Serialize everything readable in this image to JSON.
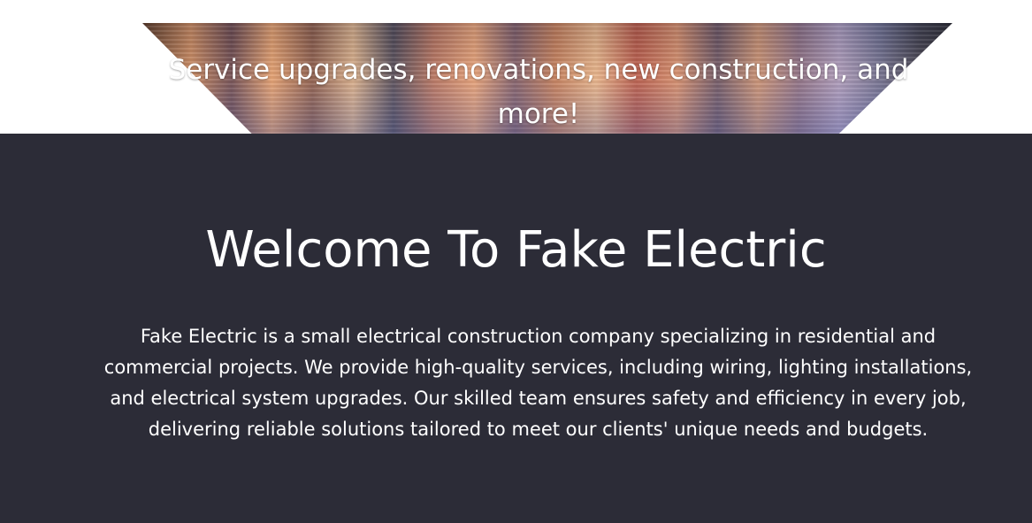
{
  "hero": {
    "tagline": "Service upgrades, renovations, new construction, and more!"
  },
  "welcome": {
    "title": "Welcome To Fake Electric",
    "body": "Fake Electric is a small electrical construction company specializing in residential and commercial projects. We provide high-quality services, including wiring, lighting installations, and electrical system upgrades. Our skilled team ensures safety and efficiency in every job, delivering reliable solutions tailored to meet our clients' unique needs and budgets."
  },
  "colors": {
    "dark_background": "#2c2c37",
    "text": "#ffffff",
    "indicator_dot": "#d0201a"
  }
}
